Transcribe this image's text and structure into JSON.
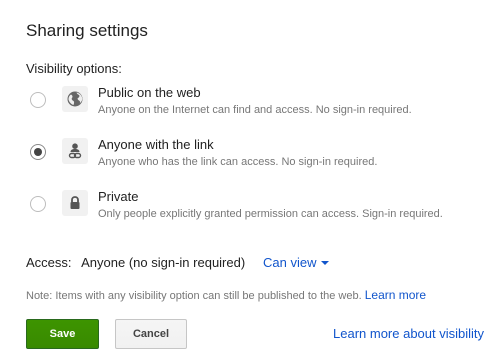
{
  "dialog": {
    "title": "Sharing settings",
    "visibility_label": "Visibility options:"
  },
  "options": [
    {
      "title": "Public on the web",
      "description": "Anyone on the Internet can find and access. No sign-in required.",
      "icon": "globe-icon",
      "selected": false
    },
    {
      "title": "Anyone with the link",
      "description": "Anyone who has the link can access. No sign-in required.",
      "icon": "person-link-icon",
      "selected": true
    },
    {
      "title": "Private",
      "description": "Only people explicitly granted permission can access. Sign-in required.",
      "icon": "lock-icon",
      "selected": false
    }
  ],
  "access": {
    "label": "Access:",
    "value": "Anyone (no sign-in required)",
    "permission": "Can view"
  },
  "note": {
    "text": "Note: Items with any visibility option can still be published to the web.",
    "link": "Learn more"
  },
  "buttons": {
    "save": "Save",
    "cancel": "Cancel"
  },
  "footer_link": "Learn more about visibility",
  "colors": {
    "link": "#1155cc",
    "save_green": "#3d9400",
    "muted_text": "#777777"
  }
}
